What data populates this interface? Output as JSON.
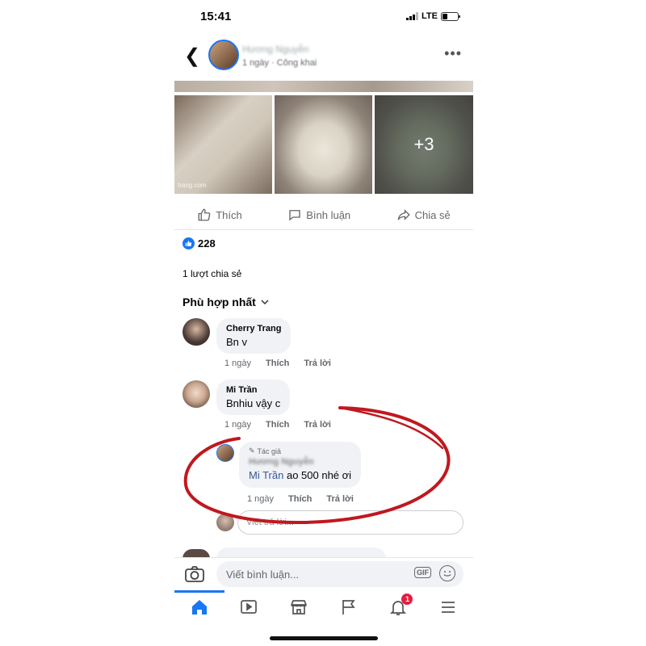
{
  "status": {
    "time": "15:41",
    "network": "LTE"
  },
  "post": {
    "author_name": "Hương Nguyễn",
    "meta": "1 ngày · Công khai",
    "photos_more": "+3",
    "watermark": "trang.com"
  },
  "actions": {
    "like": "Thích",
    "comment": "Bình luận",
    "share": "Chia sẻ"
  },
  "reactions": {
    "count": "228"
  },
  "shares_text": "1 lượt chia sẻ",
  "sort_label": "Phù hợp nhất",
  "comments": [
    {
      "name": "Cherry Trang",
      "text": "Bn v",
      "time": "1 ngày",
      "like": "Thích",
      "reply": "Trả lời"
    },
    {
      "name": "Mi Trần",
      "text": "Bnhiu vậy c",
      "time": "1 ngày",
      "like": "Thích",
      "reply": "Trả lời"
    }
  ],
  "reply": {
    "badge": "Tác giả",
    "name": "Hương Nguyễn",
    "mention": "Mi Trần",
    "text": "ao 500 nhé ơi",
    "time": "1 ngày",
    "like": "Thích",
    "reply": "Trả lời"
  },
  "reply_input_placeholder": "Viết trả lời...",
  "composer": {
    "placeholder": "Viết bình luận...",
    "gif": "GIF"
  },
  "nav": {
    "notifications_badge": "1"
  },
  "colors": {
    "accent": "#1877f2",
    "annotation": "#c0181f",
    "badge": "#e41e3f"
  }
}
